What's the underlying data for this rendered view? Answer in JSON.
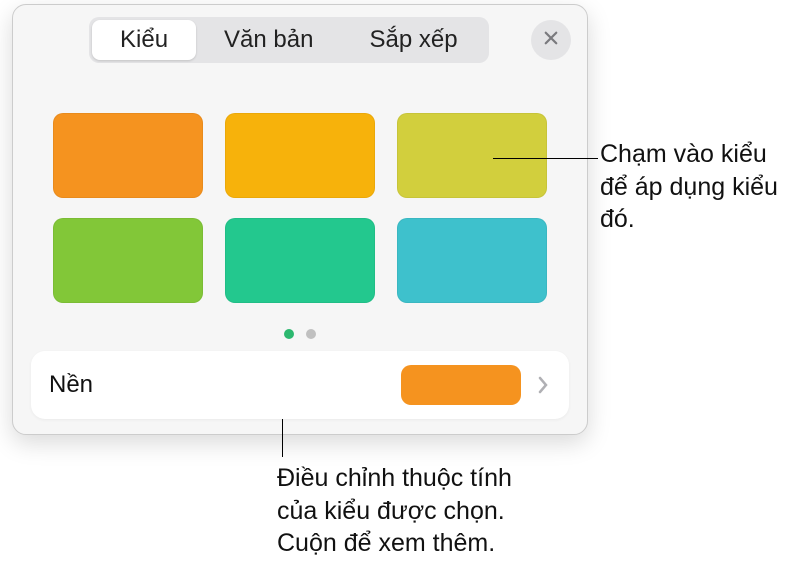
{
  "tabs": {
    "style": "Kiểu",
    "text": "Văn bản",
    "arrange": "Sắp xếp"
  },
  "swatches": [
    {
      "color": "#f5931f"
    },
    {
      "color": "#f7b20b"
    },
    {
      "color": "#d2cf3d"
    },
    {
      "color": "#82c738"
    },
    {
      "color": "#23c88e"
    },
    {
      "color": "#3ec1cc"
    }
  ],
  "background_row": {
    "label": "Nền",
    "preview_color": "#f5931f"
  },
  "callout_right": "Chạm vào kiểu để áp dụng kiểu đó.",
  "callout_bottom": "Điều chỉnh thuộc tính của kiểu được chọn. Cuộn để xem thêm."
}
